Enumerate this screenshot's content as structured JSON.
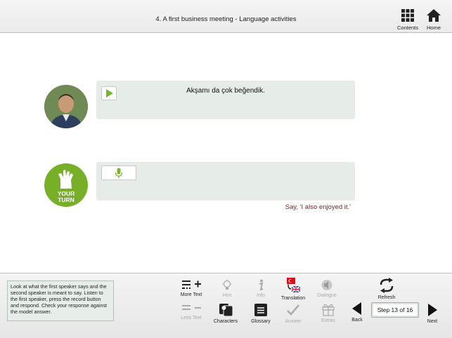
{
  "header": {
    "title": "4. A first business meeting - Language activities",
    "contents_label": "Contents",
    "home_label": "Home"
  },
  "dialogue": {
    "speaker_line": "Akşamı da çok beğendik.",
    "your_turn_label_1": "YOUR",
    "your_turn_label_2": "TURN",
    "say_line": "Say, 'I also enjoyed it.'"
  },
  "footer": {
    "instructions": "Look at what the first speaker says and the second speaker is meant to say. Listen to the first speaker, press the record button and respond. Check your response against the model answer.",
    "more_text": "More Text",
    "less_text": "Less Text",
    "hint": "Hint",
    "characters": "Characters",
    "info": "Info",
    "glossary": "Glossary",
    "translation": "Translation",
    "answer": "Answer",
    "dialogue": "Dialogue",
    "extras": "Extras",
    "refresh": "Refresh",
    "back": "Back",
    "next": "Next",
    "step": "Step 13 of 16"
  },
  "colors": {
    "your_turn_green": "#77b028",
    "say_red": "#7a1f1f",
    "bubble_bg": "#e6ece8",
    "icon_green": "#7ab32e"
  }
}
